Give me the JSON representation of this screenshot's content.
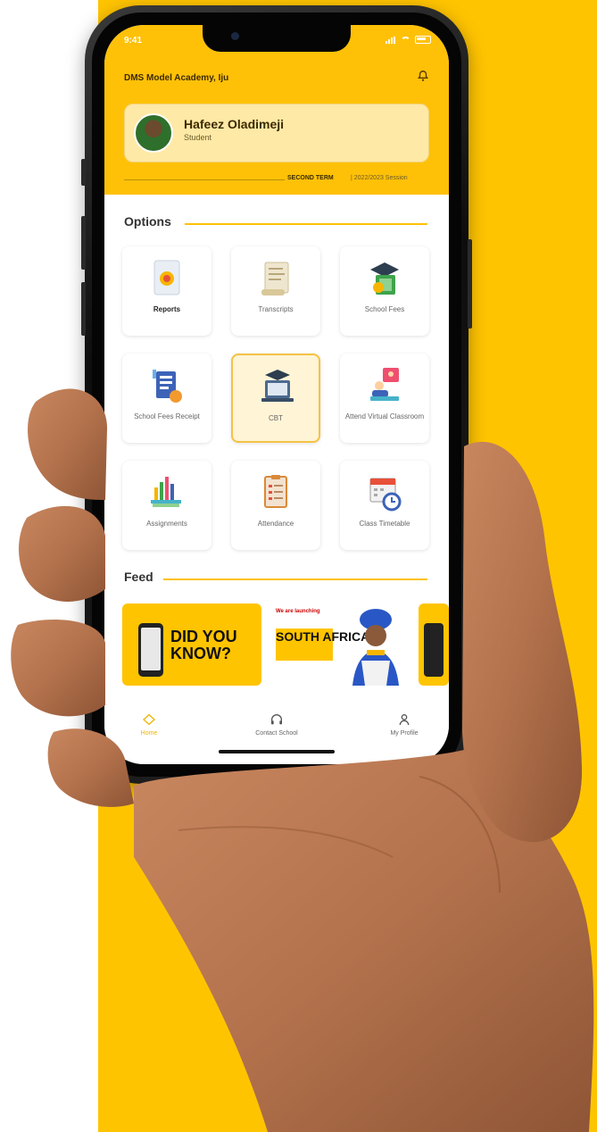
{
  "status": {
    "time": "9:41"
  },
  "header": {
    "school": "DMS Model Academy, Iju",
    "student_name": "Hafeez Oladimeji",
    "student_role": "Student",
    "term": "SECOND TERM",
    "session": "| 2022/2023 Session"
  },
  "options": {
    "title": "Options",
    "items": [
      {
        "label": "Reports",
        "icon": "report-icon"
      },
      {
        "label": "Transcripts",
        "icon": "transcript-icon"
      },
      {
        "label": "School Fees",
        "icon": "school-fees-icon"
      },
      {
        "label": "School Fees Receipt",
        "icon": "receipt-icon"
      },
      {
        "label": "CBT",
        "icon": "cbt-icon"
      },
      {
        "label": "Attend Virtual Classroom",
        "icon": "virtual-classroom-icon"
      },
      {
        "label": "Assignments",
        "icon": "assignments-icon"
      },
      {
        "label": "Attendance",
        "icon": "attendance-icon"
      },
      {
        "label": "Class Timetable",
        "icon": "timetable-icon"
      }
    ]
  },
  "feed": {
    "title": "Feed",
    "cards": [
      {
        "headline": "DID YOU KNOW?"
      },
      {
        "kicker": "We are launching",
        "headline": "SOUTH AFRICA",
        "tag": ""
      },
      {
        "headline": ""
      }
    ]
  },
  "tabbar": {
    "items": [
      {
        "label": "Home",
        "icon": "home-icon"
      },
      {
        "label": "Contact School",
        "icon": "headphones-icon"
      },
      {
        "label": "My Profile",
        "icon": "profile-icon"
      }
    ]
  },
  "colors": {
    "accent": "#FFC107",
    "brand_yellow": "#FFC400"
  }
}
